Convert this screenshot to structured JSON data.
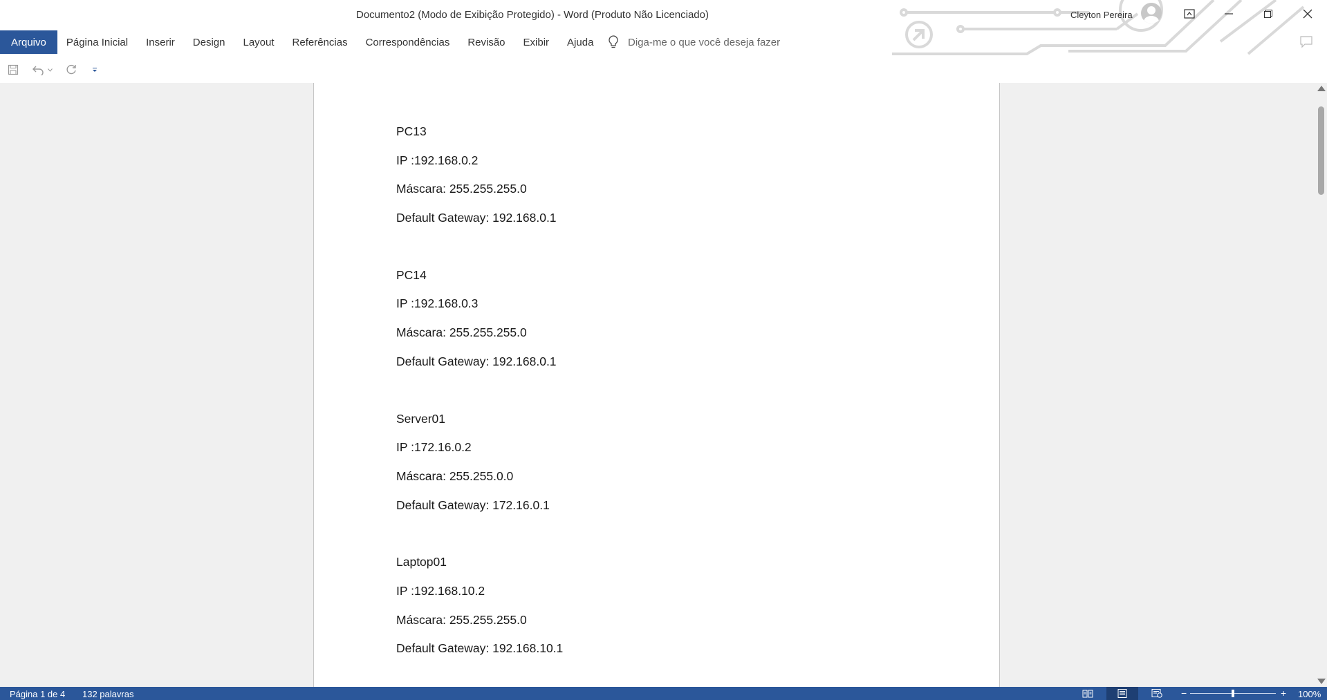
{
  "window": {
    "title": "Documento2 (Modo de Exibição Protegido)  -  Word (Produto Não Licenciado)",
    "user_name": "Cleyton Pereira",
    "controls": [
      "ribbon-display-options-icon",
      "minimize-icon",
      "restore-icon",
      "close-icon"
    ]
  },
  "ribbon": {
    "tabs": [
      {
        "label": "Arquivo",
        "active": true
      },
      {
        "label": "Página Inicial"
      },
      {
        "label": "Inserir"
      },
      {
        "label": "Design"
      },
      {
        "label": "Layout"
      },
      {
        "label": "Referências"
      },
      {
        "label": "Correspondências"
      },
      {
        "label": "Revisão"
      },
      {
        "label": "Exibir"
      },
      {
        "label": "Ajuda"
      }
    ],
    "tell_me_placeholder": "Diga-me o que você deseja fazer"
  },
  "quick_access": [
    "save-icon",
    "undo-icon",
    "undo-dropdown-icon",
    "redo-icon",
    "customize-qat-icon"
  ],
  "document": {
    "blocks": [
      {
        "name": "PC13",
        "ip": "IP :192.168.0.2",
        "mask": "Máscara: 255.255.255.0",
        "gateway": "Default Gateway: 192.168.0.1"
      },
      {
        "name": "PC14",
        "ip": "IP :192.168.0.3",
        "mask": "Máscara: 255.255.255.0",
        "gateway": "Default Gateway: 192.168.0.1"
      },
      {
        "name": "Server01",
        "ip": "IP :172.16.0.2",
        "mask": "Máscara: 255.255.0.0",
        "gateway": "Default Gateway: 172.16.0.1"
      },
      {
        "name": "Laptop01",
        "ip": "IP :192.168.10.2",
        "mask": "Máscara: 255.255.255.0",
        "gateway": "Default Gateway: 192.168.10.1"
      }
    ]
  },
  "status": {
    "page": "Página 1 de 4",
    "words": "132 palavras",
    "zoom": "100%",
    "zoom_fraction": 0.5,
    "active_view": "print-layout"
  },
  "colors": {
    "accent": "#2b579a",
    "workspace": "#f0f0f0"
  }
}
